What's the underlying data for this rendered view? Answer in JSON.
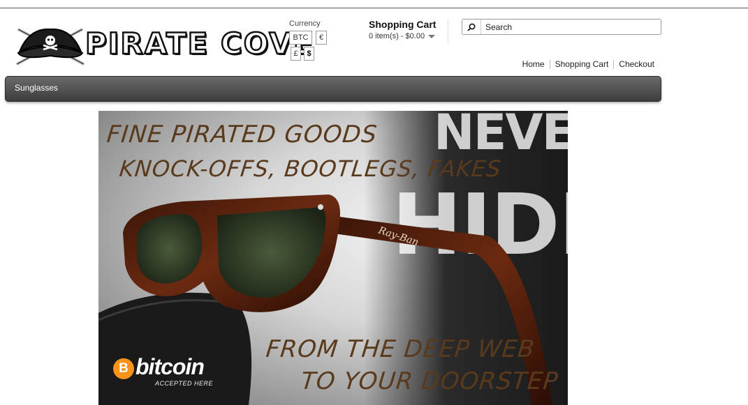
{
  "logo": {
    "text": "PIRATE COVE",
    "icon": "pirate-hat-skull-icon"
  },
  "currency": {
    "label": "Currency",
    "options": [
      "BTC",
      "€",
      "£",
      "$"
    ],
    "selected": "$"
  },
  "cart": {
    "title": "Shopping Cart",
    "summary": "0 item(s) - $0.00"
  },
  "search": {
    "placeholder": "Search",
    "icon": "search-icon"
  },
  "links": [
    "Home",
    "Shopping Cart",
    "Checkout"
  ],
  "nav": {
    "items": [
      "Sunglasses"
    ]
  },
  "banner": {
    "line1": "FINE PIRATED GOODS",
    "line2": "KNOCK-OFFS, BOOTLEGS, FAKES",
    "line3": "FROM THE DEEP WEB",
    "line4": "TO YOUR DOORSTEP",
    "bg_word_1": "NEVER",
    "bg_word_2": "HIDE",
    "brand_mark": "Ray-Ban",
    "bitcoin_word": "bitcoin",
    "bitcoin_symbol": "B",
    "bitcoin_sub": "ACCEPTED HERE",
    "colors": {
      "text": "#5a3a1c",
      "bitcoin": "#f7931a"
    }
  }
}
